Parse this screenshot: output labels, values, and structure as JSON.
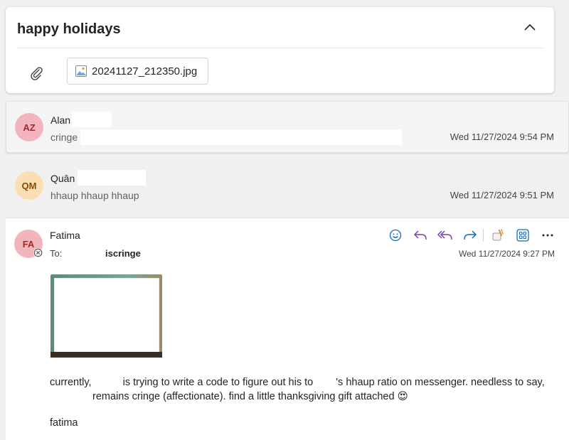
{
  "thread": {
    "subject": "happy holidays",
    "attachment": {
      "filename": "20241127_212350.jpg"
    }
  },
  "messages": [
    {
      "initials": "AZ",
      "sender": "Alan",
      "preview": "cringe",
      "date": "Wed 11/27/2024 9:54 PM"
    },
    {
      "initials": "QM",
      "sender": "Quân",
      "preview": "hhaup hhaup hhaup",
      "date": "Wed 11/27/2024 9:51 PM"
    }
  ],
  "open_message": {
    "initials": "FA",
    "sender": "Fatima",
    "to_label": "To:",
    "recipient": "iscringe",
    "date": "Wed 11/27/2024 9:27 PM",
    "body_1": "currently,",
    "body_2": "is trying to write a code to figure out his to",
    "body_3": "'s hhaup ratio on messenger. needless to say,",
    "body_4": "remains cringe (affectionate). find a little thanksgiving gift attached",
    "emoji": "😍",
    "signature": "fatima",
    "actions": [
      "emoji-react-icon",
      "reply-icon",
      "reply-all-icon",
      "forward-icon",
      "apps-icon",
      "more-icon"
    ]
  },
  "colors": {
    "accent": "#0f6cbd",
    "reply_purple": "#7a3fb0",
    "avatar_pink": "#f3b5bd",
    "avatar_orange": "#fcdeb3"
  }
}
